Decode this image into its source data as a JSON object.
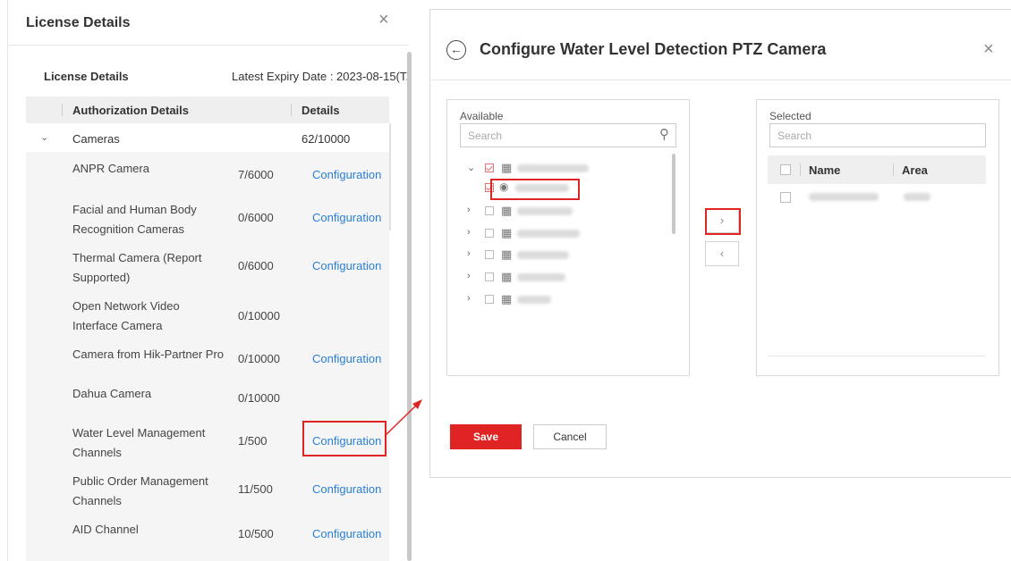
{
  "left_panel": {
    "title": "License Details",
    "close_glyph": "×",
    "subtitle": "License Details",
    "expiry": "Latest Expiry Date : 2023-08-15(T..",
    "table": {
      "col_authorization": "Authorization Details",
      "col_details": "Details",
      "group": {
        "name": "Cameras",
        "count": "62/10000"
      },
      "rows": [
        {
          "name": "ANPR Camera",
          "count": "7/6000",
          "config": "Configuration"
        },
        {
          "name": "Facial and Human Body Recognition Cameras",
          "count": "0/6000",
          "config": "Configuration"
        },
        {
          "name": "Thermal Camera (Report Supported)",
          "count": "0/6000",
          "config": "Configuration"
        },
        {
          "name": "Open Network Video Interface Camera",
          "count": "0/10000",
          "config": ""
        },
        {
          "name": "Camera from Hik-Partner Pro",
          "count": "0/10000",
          "config": "Configuration"
        },
        {
          "name": "Dahua Camera",
          "count": "0/10000",
          "config": ""
        },
        {
          "name": "Water Level Management Channels",
          "count": "1/500",
          "config": "Configuration"
        },
        {
          "name": "Public Order Management Channels",
          "count": "11/500",
          "config": "Configuration"
        },
        {
          "name": "AID Channel",
          "count": "10/500",
          "config": "Configuration"
        }
      ]
    }
  },
  "dialog": {
    "back_glyph": "←",
    "title": "Configure Water Level Detection PTZ Camera",
    "close_glyph": "×",
    "available": {
      "label": "Available",
      "search_placeholder": "Search"
    },
    "selected": {
      "label": "Selected",
      "search_placeholder": "Search",
      "col_name": "Name",
      "col_area": "Area"
    },
    "move_right": "›",
    "move_left": "‹",
    "save_label": "Save",
    "cancel_label": "Cancel"
  },
  "icons": {
    "search": "search-icon",
    "building": "building-icon",
    "camera": "ptz-camera-icon"
  },
  "colors": {
    "accent": "#e02424",
    "link": "#2a7fd4"
  }
}
